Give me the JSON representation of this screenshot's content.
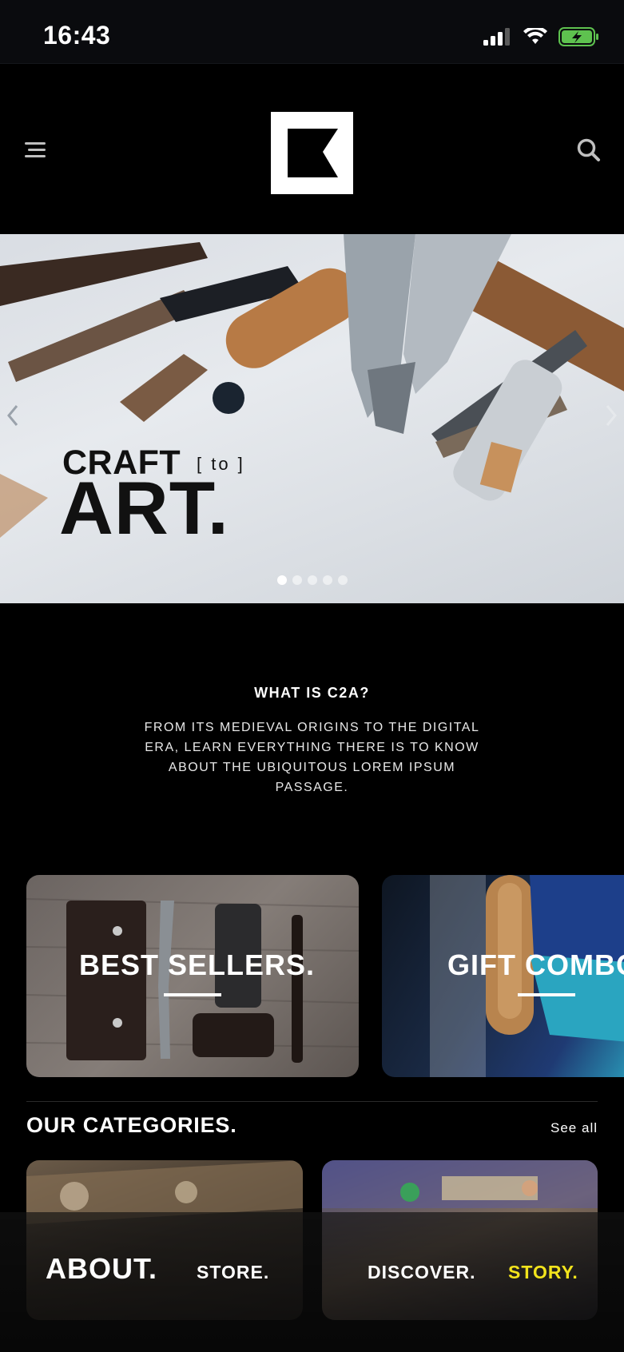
{
  "status_bar": {
    "time": "16:43",
    "icons": [
      "cellular-signal-icon",
      "wifi-icon",
      "battery-charging-icon"
    ],
    "battery_color": "#5ec24f"
  },
  "header": {
    "menu_icon": "hamburger-menu-icon",
    "logo_letter": "K",
    "search_icon": "search-icon"
  },
  "hero": {
    "title_small": "CRAFT",
    "title_to": "[ to ]",
    "title_big": "ART.",
    "prev_icon": "chevron-left-icon",
    "next_icon": "chevron-right-icon",
    "slide_count": 5,
    "active_slide": 1
  },
  "intro": {
    "title": "WHAT IS C2A?",
    "text": "FROM ITS MEDIEVAL ORIGINS TO THE DIGITAL ERA, LEARN EVERYTHING THERE IS TO KNOW ABOUT THE UBIQUITOUS LOREM IPSUM PASSAGE."
  },
  "promos": [
    {
      "label": "BEST SELLERS."
    },
    {
      "label": "GIFT COMBO"
    }
  ],
  "categories": {
    "title": "OUR CATEGORIES.",
    "see_all": "See all"
  },
  "bottom_nav": {
    "items": [
      {
        "label": "ABOUT."
      },
      {
        "label": "STORE."
      },
      {
        "label": "DISCOVER."
      },
      {
        "label": "STORY."
      }
    ],
    "active_color": "#f2e31c"
  }
}
